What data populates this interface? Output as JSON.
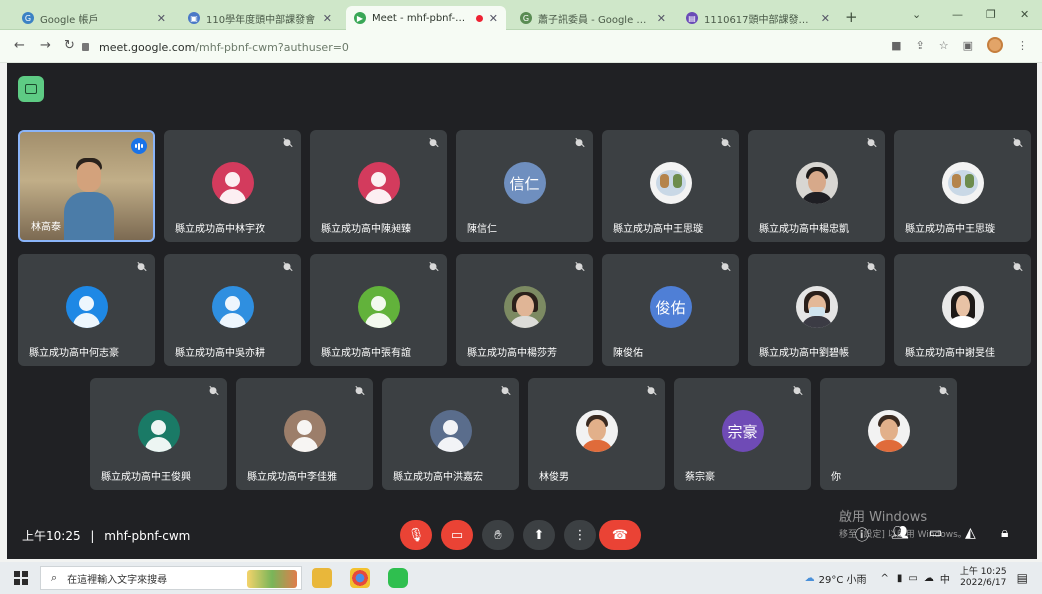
{
  "browser": {
    "tabs": [
      {
        "title": "Google 帳戶",
        "favicon_color": "#3b82c4",
        "active": false
      },
      {
        "title": "110學年度頭中部課發會",
        "favicon_color": "#4a78c7",
        "active": false
      },
      {
        "title": "Meet - mhf-pbnf-cwm",
        "favicon_color": "#3aa757",
        "active": true
      },
      {
        "title": "蕭子訊委員 - Google 搜尋",
        "favicon_color": "#5a8c53",
        "active": false
      },
      {
        "title": "1110617頭中部課發會會議記錄",
        "favicon_color": "#6a4bb7",
        "active": false
      }
    ],
    "url": {
      "host": "meet.google.com",
      "path": "/mhf-pbnf-cwm?authuser=0"
    }
  },
  "meet": {
    "meeting_code": "mhf-pbnf-cwm",
    "time": "上午10:25",
    "separator": "|",
    "participants": [
      {
        "name": "林高泰",
        "kind": "video",
        "speaking": true
      },
      {
        "name": "縣立成功高中林宇孜",
        "kind": "avatar",
        "color": "#d33b5d"
      },
      {
        "name": "縣立成功高中陳昶臻",
        "kind": "avatar",
        "color": "#d33b5d"
      },
      {
        "name": "陳信仁",
        "kind": "initials",
        "initials": "信仁",
        "color": "#6f8fbf"
      },
      {
        "name": "縣立成功高中王思璇",
        "kind": "photo",
        "color": "#c9d8e6"
      },
      {
        "name": "縣立成功高中楊忠凱",
        "kind": "photo",
        "color": "#d8d6d2"
      },
      {
        "name": "縣立成功高中王思璇",
        "kind": "photo",
        "color": "#c9d8e6"
      },
      {
        "name": "縣立成功高中何志豪",
        "kind": "avatar",
        "color": "#1e88e5"
      },
      {
        "name": "縣立成功高中吳亦耕",
        "kind": "avatar",
        "color": "#2f8fe0"
      },
      {
        "name": "縣立成功高中張有誼",
        "kind": "avatar",
        "color": "#62b23b"
      },
      {
        "name": "縣立成功高中楊莎芳",
        "kind": "photo",
        "color": "#7c8a62"
      },
      {
        "name": "陳俊佑",
        "kind": "initials",
        "initials": "俊佑",
        "color": "#4f7fd6"
      },
      {
        "name": "縣立成功高中劉碧帳",
        "kind": "photo",
        "color": "#e5e5e5"
      },
      {
        "name": "縣立成功高中謝旻佳",
        "kind": "photo",
        "color": "#e9e9e9"
      },
      {
        "name": "縣立成功高中王俊興",
        "kind": "avatar",
        "color": "#1a7a66"
      },
      {
        "name": "縣立成功高中李佳雅",
        "kind": "avatar",
        "color": "#9c7e6a"
      },
      {
        "name": "縣立成功高中洪嘉宏",
        "kind": "avatar",
        "color": "#5a6d8c"
      },
      {
        "name": "林俊男",
        "kind": "photo",
        "color": "#f2f2f2"
      },
      {
        "name": "蔡宗豪",
        "kind": "initials",
        "initials": "宗豪",
        "color": "#6f4bb6"
      },
      {
        "name": "你",
        "kind": "photo",
        "color": "#f2f2f2"
      }
    ],
    "controls": {
      "mic": "mic-off",
      "camera": "camera-off",
      "raise_hand": "hand",
      "present": "present",
      "more": "⋮",
      "leave": "leave-call"
    },
    "watermark": {
      "line1": "啟用 Windows",
      "line2": "移至 [設定] 以啟用 Windows。"
    }
  },
  "taskbar": {
    "search_placeholder": "在這裡輸入文字來搜尋",
    "weather": "29°C 小雨",
    "ime": "中",
    "clock_time": "上午 10:25",
    "clock_date": "2022/6/17"
  }
}
